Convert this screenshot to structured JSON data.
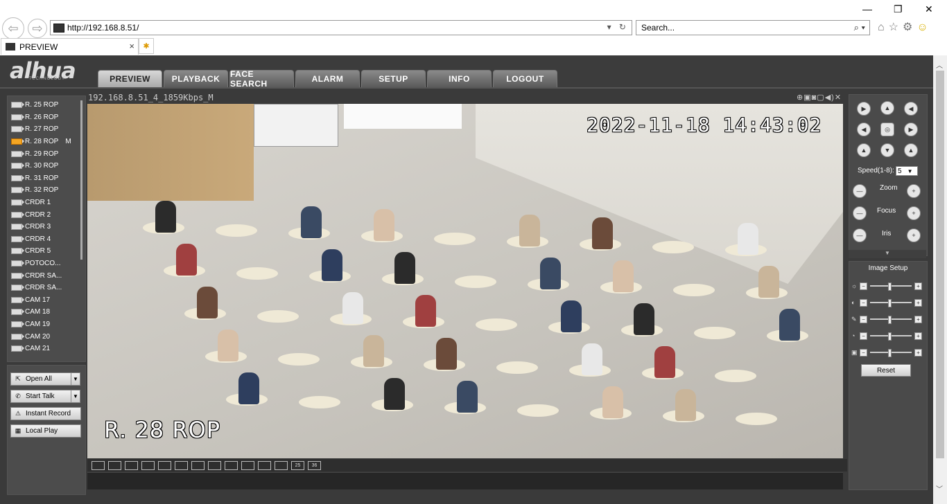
{
  "browser": {
    "address": "http://192.168.8.51/",
    "search_placeholder": "Search...",
    "tab_title": "PREVIEW",
    "tab_close": "×",
    "window_min": "—",
    "window_restore": "❐",
    "window_close": "✕"
  },
  "app": {
    "logo": "alhua",
    "logo_sub": "TECHNOLOGY",
    "nav": [
      "PREVIEW",
      "PLAYBACK",
      "FACE SEARCH",
      "ALARM",
      "SETUP",
      "INFO",
      "LOGOUT"
    ],
    "active_nav": "PREVIEW"
  },
  "cameras": [
    {
      "label": "R. 25 ROP",
      "tag": ""
    },
    {
      "label": "R. 26 ROP",
      "tag": ""
    },
    {
      "label": "R. 27 ROP",
      "tag": ""
    },
    {
      "label": "R. 28 ROP",
      "tag": "M",
      "active": true
    },
    {
      "label": "R. 29 ROP",
      "tag": ""
    },
    {
      "label": "R. 30 ROP",
      "tag": ""
    },
    {
      "label": "R. 31 ROP",
      "tag": ""
    },
    {
      "label": "R. 32 ROP",
      "tag": ""
    },
    {
      "label": "CRDR 1",
      "tag": ""
    },
    {
      "label": "CRDR 2",
      "tag": ""
    },
    {
      "label": "CRDR 3",
      "tag": ""
    },
    {
      "label": "CRDR 4",
      "tag": ""
    },
    {
      "label": "CRDR 5",
      "tag": ""
    },
    {
      "label": "POTOCO...",
      "tag": ""
    },
    {
      "label": "CRDR SA...",
      "tag": ""
    },
    {
      "label": "CRDR SA...",
      "tag": ""
    },
    {
      "label": "CAM 17",
      "tag": ""
    },
    {
      "label": "CAM 18",
      "tag": ""
    },
    {
      "label": "CAM 19",
      "tag": ""
    },
    {
      "label": "CAM 20",
      "tag": ""
    },
    {
      "label": "CAM 21",
      "tag": ""
    }
  ],
  "actions": {
    "open_all": "Open All",
    "start_talk": "Start Talk",
    "instant_record": "Instant Record",
    "local_play": "Local Play"
  },
  "video": {
    "stream_title": "192.168.8.51_4_1859Kbps_M",
    "osd_time": "2022-11-18 14:43:02",
    "osd_name": "R. 28 ROP"
  },
  "layout_buttons": [
    "",
    "",
    "",
    "",
    "",
    "",
    "",
    "",
    "",
    "",
    "",
    "",
    "25",
    "36"
  ],
  "ptz": {
    "speed_label": "Speed(1-8):",
    "speed_value": "5",
    "zoom": "Zoom",
    "focus": "Focus",
    "iris": "Iris"
  },
  "image_setup": {
    "title": "Image Setup",
    "reset": "Reset"
  }
}
